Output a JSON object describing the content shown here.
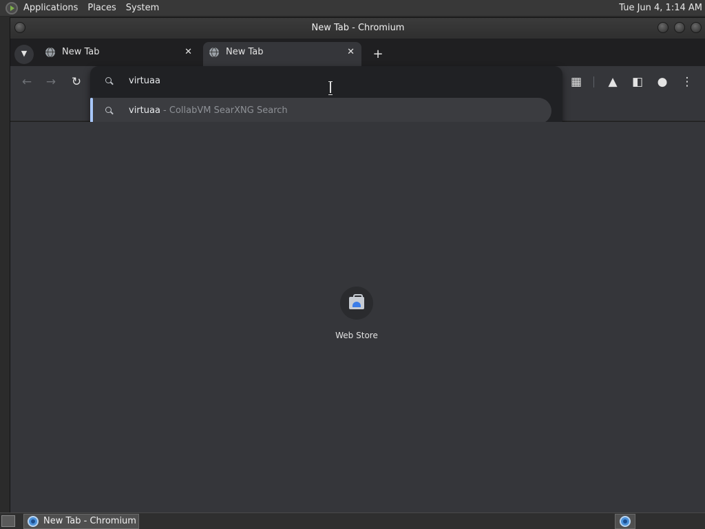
{
  "top_panel": {
    "menus": [
      "Applications",
      "Places",
      "System"
    ],
    "clock": "Tue Jun  4,  1:14 AM"
  },
  "window": {
    "title": "New Tab - Chromium"
  },
  "tabs": [
    {
      "label": "New Tab",
      "active": false
    },
    {
      "label": "New Tab",
      "active": true
    }
  ],
  "tab_close_glyph": "✕",
  "new_tab_glyph": "+",
  "omnibox": {
    "text": "virtuaa",
    "suggestion": {
      "query": "virtuaa",
      "source": " - CollabVM SearXNG Search"
    }
  },
  "new_tab_page": {
    "shortcuts": [
      {
        "label": "Web Store",
        "icon": "web-store-icon"
      }
    ]
  },
  "taskbar": {
    "items": [
      {
        "label": "New Tab - Chromium",
        "icon": "chromium-icon"
      }
    ]
  },
  "colors": {
    "accent": "#a8c7fa",
    "toolbar": "#35363a",
    "omnibox": "#202124"
  }
}
